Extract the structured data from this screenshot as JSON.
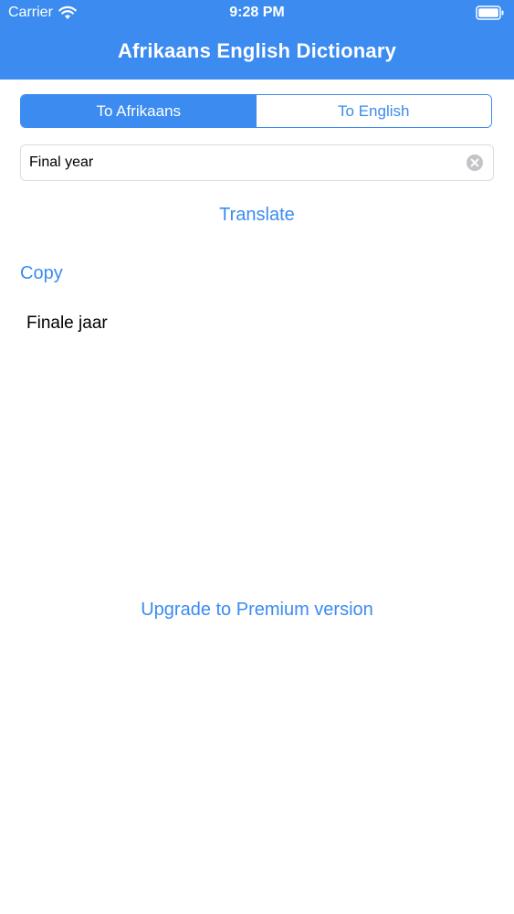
{
  "status_bar": {
    "carrier": "Carrier",
    "time": "9:28 PM"
  },
  "header": {
    "title": "Afrikaans English Dictionary",
    "color": "#3b8bf0"
  },
  "segmented_control": {
    "options": [
      "To Afrikaans",
      "To English"
    ],
    "selected": "To Afrikaans"
  },
  "search": {
    "value": "Final year",
    "placeholder": ""
  },
  "actions": {
    "translate_label": "Translate",
    "copy_label": "Copy",
    "premium_label": "Upgrade to Premium version"
  },
  "result": {
    "text": "Finale jaar"
  },
  "icons": {
    "wifi": "wifi-icon",
    "battery": "battery-icon",
    "clear": "clear-icon"
  }
}
